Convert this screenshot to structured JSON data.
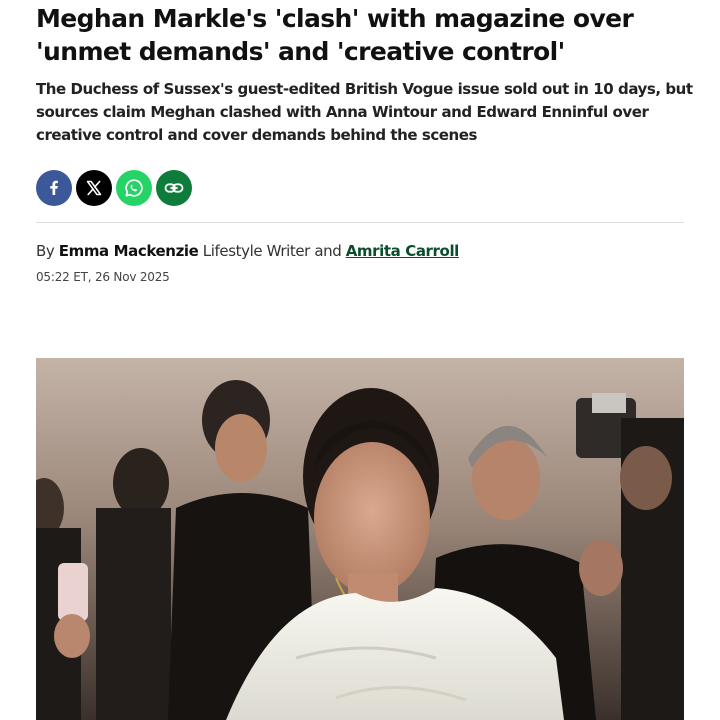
{
  "article": {
    "headline": "Meghan Markle's 'clash' with magazine over 'unmet demands' and 'creative control'",
    "standfirst": "The Duchess of Sussex's guest-edited British Vogue issue sold out in 10 days, but sources claim Meghan clashed with Anna Wintour and Edward Enninful over creative control and cover demands behind the scenes"
  },
  "share": {
    "buttons": [
      {
        "icon": "facebook-icon",
        "color": "#3b5998"
      },
      {
        "icon": "x-icon",
        "color": "#000000"
      },
      {
        "icon": "whatsapp-icon",
        "color": "#25d366"
      },
      {
        "icon": "link-icon",
        "color": "#0e7c3a"
      }
    ]
  },
  "byline": {
    "prefix": "By",
    "author1": "Emma Mackenzie",
    "role1": "Lifestyle Writer",
    "conjunction": "and",
    "author2": "Amrita Carroll",
    "timestamp": "05:22 ET, 26 Nov 2025"
  },
  "hero_image": {
    "subject": "photo"
  },
  "colors": {
    "author_link": "#0a4e2c",
    "divider": "#dcdcdc"
  }
}
